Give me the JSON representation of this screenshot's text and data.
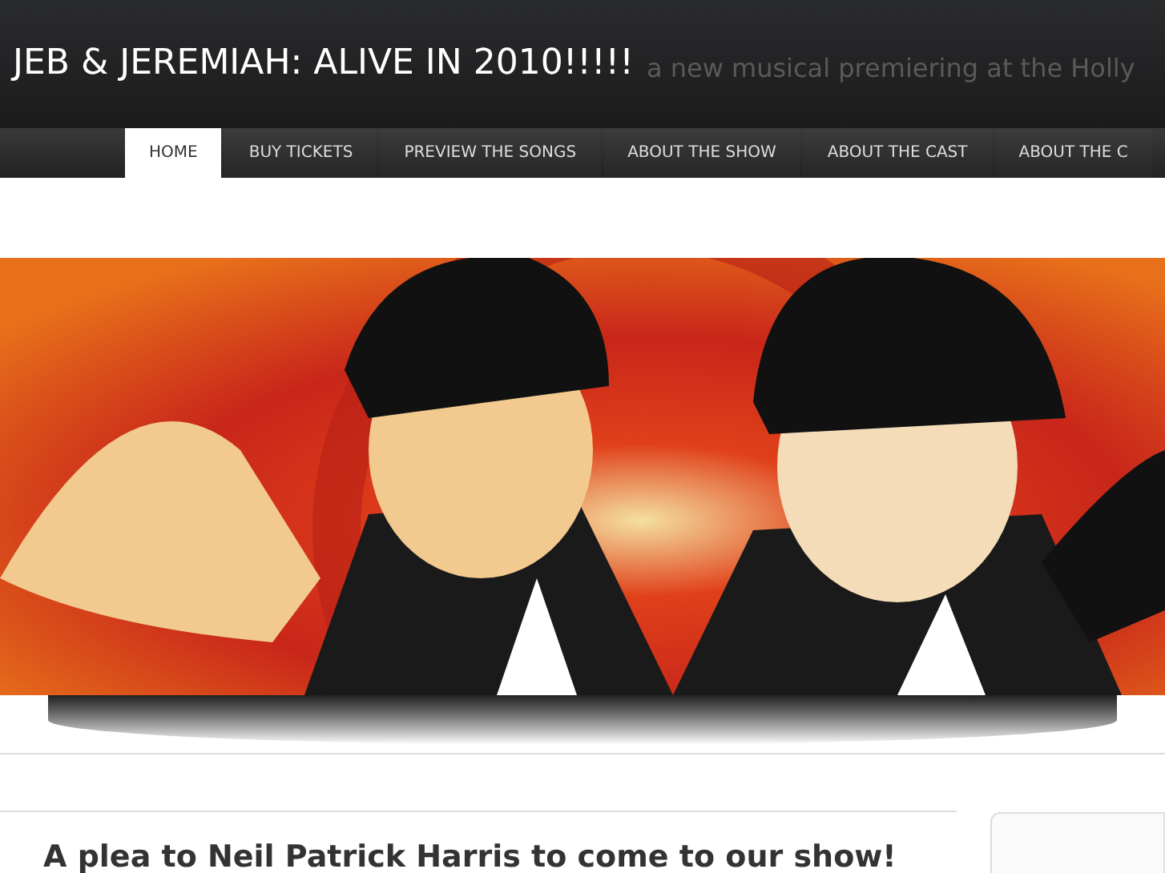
{
  "header": {
    "title": "JEB & JEREMIAH: ALIVE IN 2010!!!!!",
    "tagline": "a new musical premiering at the Holly"
  },
  "nav": [
    {
      "label": "HOME",
      "selected": true
    },
    {
      "label": "BUY TICKETS",
      "selected": false
    },
    {
      "label": "PREVIEW THE SONGS",
      "selected": false
    },
    {
      "label": "ABOUT THE SHOW",
      "selected": false
    },
    {
      "label": "ABOUT THE CAST",
      "selected": false
    },
    {
      "label": "ABOUT THE C",
      "selected": false
    }
  ],
  "post": {
    "title": "A plea to Neil Patrick Harris to come to our show!"
  }
}
